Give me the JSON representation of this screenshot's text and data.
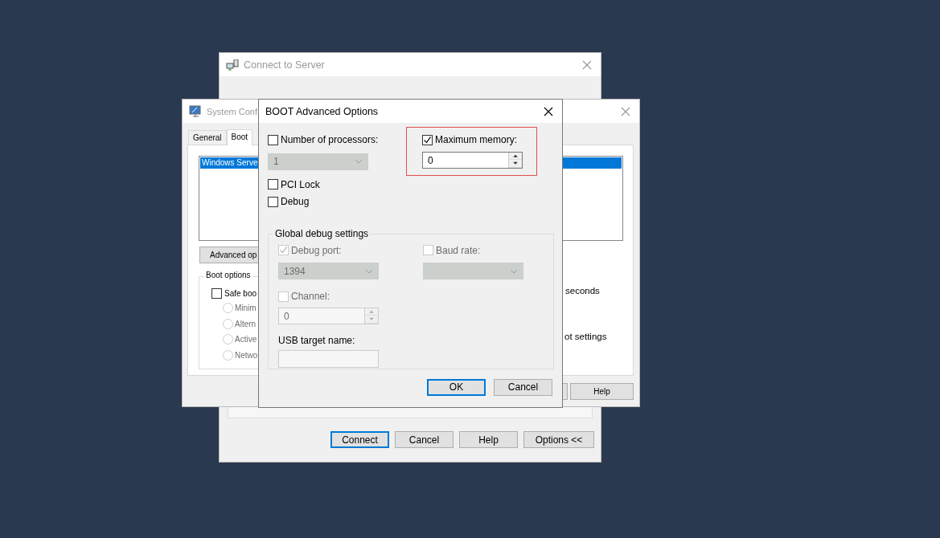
{
  "connect_window": {
    "title": "Connect to Server",
    "buttons": [
      {
        "label": "Connect",
        "focused": true
      },
      {
        "label": "Cancel",
        "focused": false
      },
      {
        "label": "Help",
        "focused": false
      },
      {
        "label": "Options <<",
        "focused": false
      }
    ]
  },
  "system_configuration": {
    "title": "System Conf",
    "tabs": [
      {
        "label": "General",
        "selected": false
      },
      {
        "label": "Boot",
        "selected": true
      }
    ],
    "boot_entries": [
      {
        "label": "Windows Serve",
        "selected": true
      }
    ],
    "advanced_button": "Advanced op",
    "boot_options": {
      "title": "Boot options",
      "safe_boot": {
        "label": "Safe boo",
        "checked": false
      },
      "modes": [
        {
          "label": "Minim",
          "selected": false,
          "disabled": true
        },
        {
          "label": "Altern",
          "selected": false,
          "disabled": true
        },
        {
          "label": "Active",
          "selected": false,
          "disabled": true
        },
        {
          "label": "Netwo",
          "selected": false,
          "disabled": true
        }
      ]
    },
    "timeout_unit": "seconds",
    "permanent_label": "ot settings",
    "help_button": "Help"
  },
  "advanced_dialog": {
    "title": "BOOT Advanced Options",
    "processors": {
      "label": "Number of processors:",
      "checked": false,
      "value": "1",
      "disabled": true
    },
    "pci_lock": {
      "label": "PCI Lock",
      "checked": false
    },
    "debug": {
      "label": "Debug",
      "checked": false
    },
    "maximum_memory": {
      "label": "Maximum memory:",
      "checked": true,
      "value": "0",
      "highlighted": true
    },
    "global_debug": {
      "title": "Global debug settings",
      "debug_port": {
        "label": "Debug port:",
        "checked": true,
        "disabled": true,
        "value": "1394"
      },
      "baud_rate": {
        "label": "Baud rate:",
        "checked": false,
        "disabled": true
      },
      "channel": {
        "label": "Channel:",
        "checked": false,
        "disabled": true,
        "value": "0"
      },
      "usb_target": {
        "label": "USB target name:"
      }
    },
    "buttons": [
      {
        "label": "OK",
        "focused": true
      },
      {
        "label": "Cancel",
        "focused": false
      }
    ]
  }
}
